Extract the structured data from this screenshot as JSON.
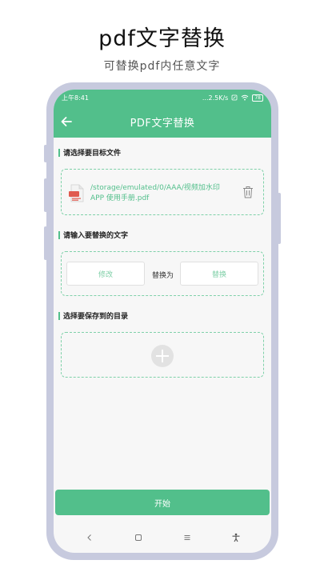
{
  "promo": {
    "title": "pdf文字替换",
    "subtitle": "可替换pdf内任意文字"
  },
  "status_bar": {
    "time": "上午8:41",
    "speed": "...2.5K/s",
    "battery": "78"
  },
  "app_bar": {
    "title": "PDF文字替换",
    "back_icon": "arrow-left-icon"
  },
  "file_section": {
    "label": "请选择要目标文件",
    "file_icon": "pdf-file-icon",
    "file_path": "/storage/emulated/0/AAA/视频加水印APP 使用手册.pdf",
    "delete_icon": "trash-icon"
  },
  "replace_section": {
    "label": "请输入要替换的文字",
    "find_placeholder": "修改",
    "replace_with_label": "替换为",
    "replace_placeholder": "替换"
  },
  "save_section": {
    "label": "选择要保存到的目录",
    "add_icon": "plus-circle-icon"
  },
  "start_button": "开始",
  "nav_bar": {
    "icons": [
      "back-icon",
      "home-icon",
      "menu-icon",
      "accessibility-icon"
    ]
  },
  "colors": {
    "accent": "#52bf8b",
    "dashed_border": "#7fd1a9",
    "phone_frame": "#c7cade"
  }
}
